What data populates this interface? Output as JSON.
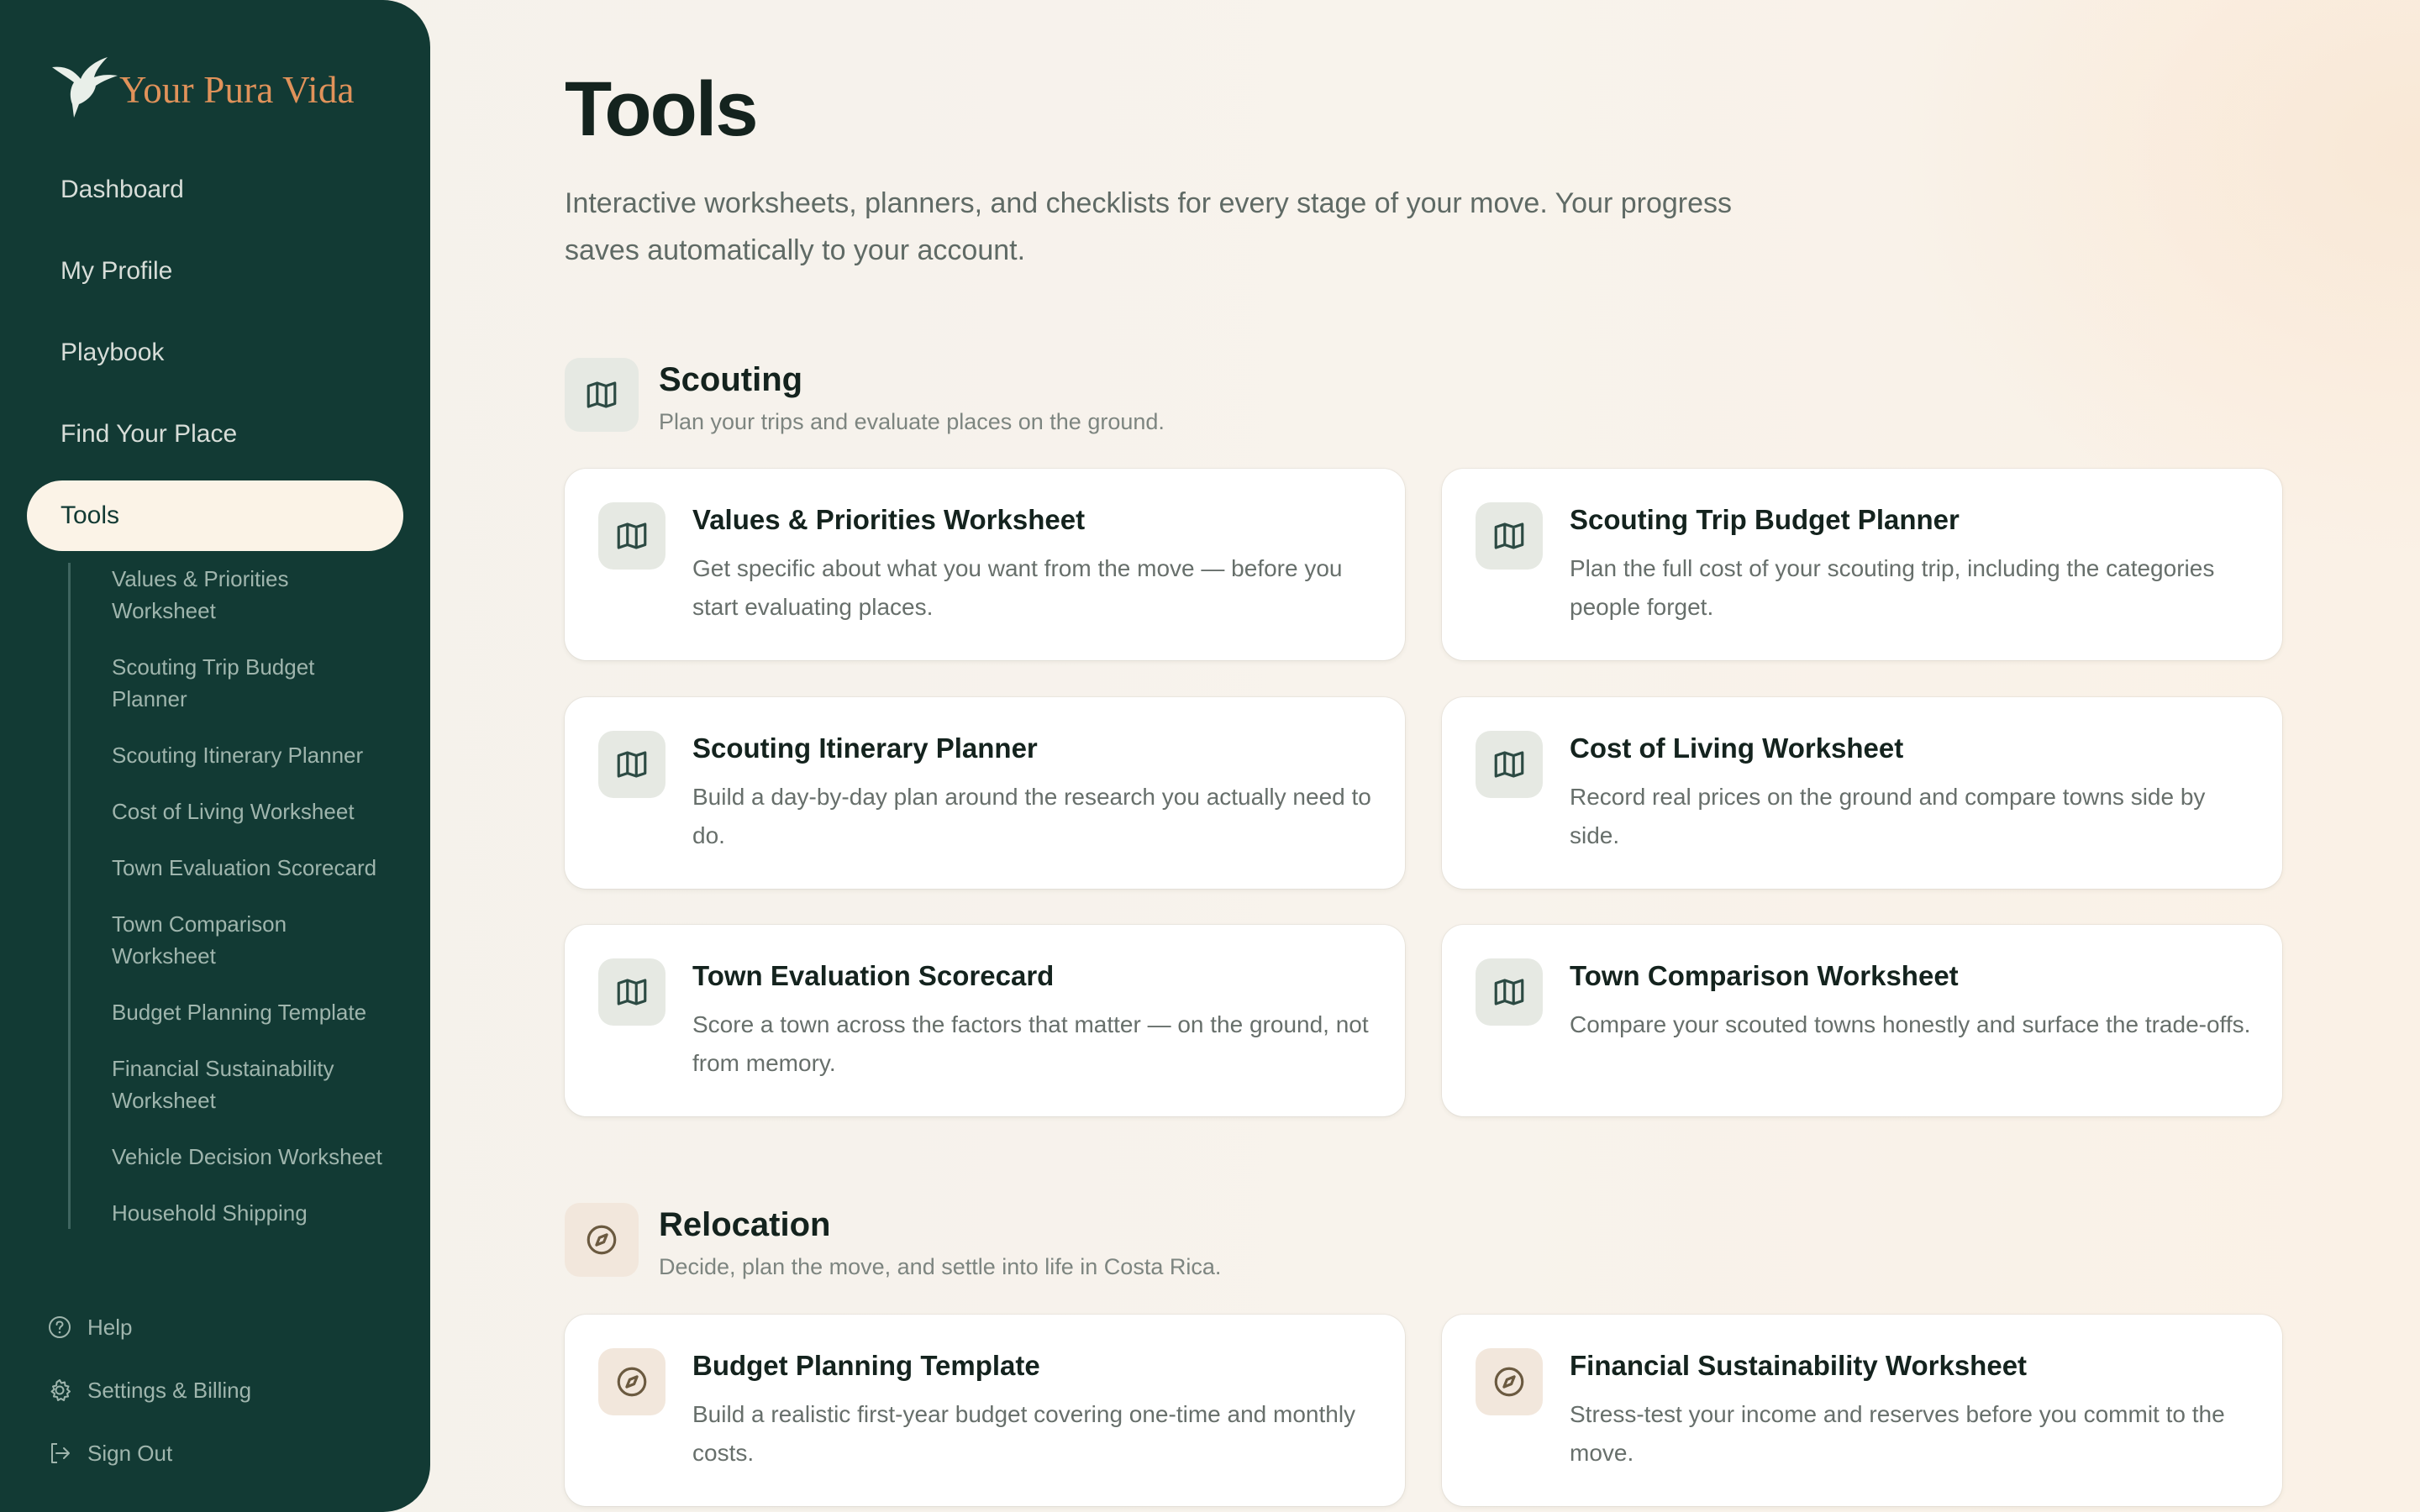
{
  "brand": {
    "name": "Your Pura Vida"
  },
  "nav": [
    {
      "label": "Dashboard"
    },
    {
      "label": "My Profile"
    },
    {
      "label": "Playbook"
    },
    {
      "label": "Find Your Place"
    },
    {
      "label": "Tools",
      "active": true
    }
  ],
  "subnav": [
    "Values & Priorities Worksheet",
    "Scouting Trip Budget Planner",
    "Scouting Itinerary Planner",
    "Cost of Living Worksheet",
    "Town Evaluation Scorecard",
    "Town Comparison Worksheet",
    "Budget Planning Template",
    "Financial Sustainability Worksheet",
    "Vehicle Decision Worksheet",
    "Household Shipping"
  ],
  "bottom": [
    {
      "label": "Help",
      "icon": "help-circle-icon"
    },
    {
      "label": "Settings & Billing",
      "icon": "gear-icon"
    },
    {
      "label": "Sign Out",
      "icon": "sign-out-icon"
    }
  ],
  "page": {
    "title": "Tools",
    "description": "Interactive worksheets, planners, and checklists for every stage of your move. Your progress saves automatically to your account."
  },
  "sections": {
    "scouting": {
      "title": "Scouting",
      "subtitle": "Plan your trips and evaluate places on the ground.",
      "icon": "map-icon",
      "cards": [
        {
          "title": "Values & Priorities Worksheet",
          "desc": "Get specific about what you want from the move — before you start evaluating places."
        },
        {
          "title": "Scouting Trip Budget Planner",
          "desc": "Plan the full cost of your scouting trip, including the categories people forget."
        },
        {
          "title": "Scouting Itinerary Planner",
          "desc": "Build a day-by-day plan around the research you actually need to do."
        },
        {
          "title": "Cost of Living Worksheet",
          "desc": "Record real prices on the ground and compare towns side by side."
        },
        {
          "title": "Town Evaluation Scorecard",
          "desc": "Score a town across the factors that matter — on the ground, not from memory."
        },
        {
          "title": "Town Comparison Worksheet",
          "desc": "Compare your scouted towns honestly and surface the trade-offs."
        }
      ]
    },
    "relocation": {
      "title": "Relocation",
      "subtitle": "Decide, plan the move, and settle into life in Costa Rica.",
      "icon": "compass-icon",
      "cards": [
        {
          "title": "Budget Planning Template",
          "desc": "Build a realistic first-year budget covering one-time and monthly costs."
        },
        {
          "title": "Financial Sustainability Worksheet",
          "desc": "Stress-test your income and reserves before you commit to the move."
        }
      ]
    }
  },
  "colors": {
    "sidebar": "#123a34",
    "brand_accent": "#e0925a",
    "active_nav_bg": "#fbf3e7",
    "page_bg": "#f6f1ea"
  }
}
